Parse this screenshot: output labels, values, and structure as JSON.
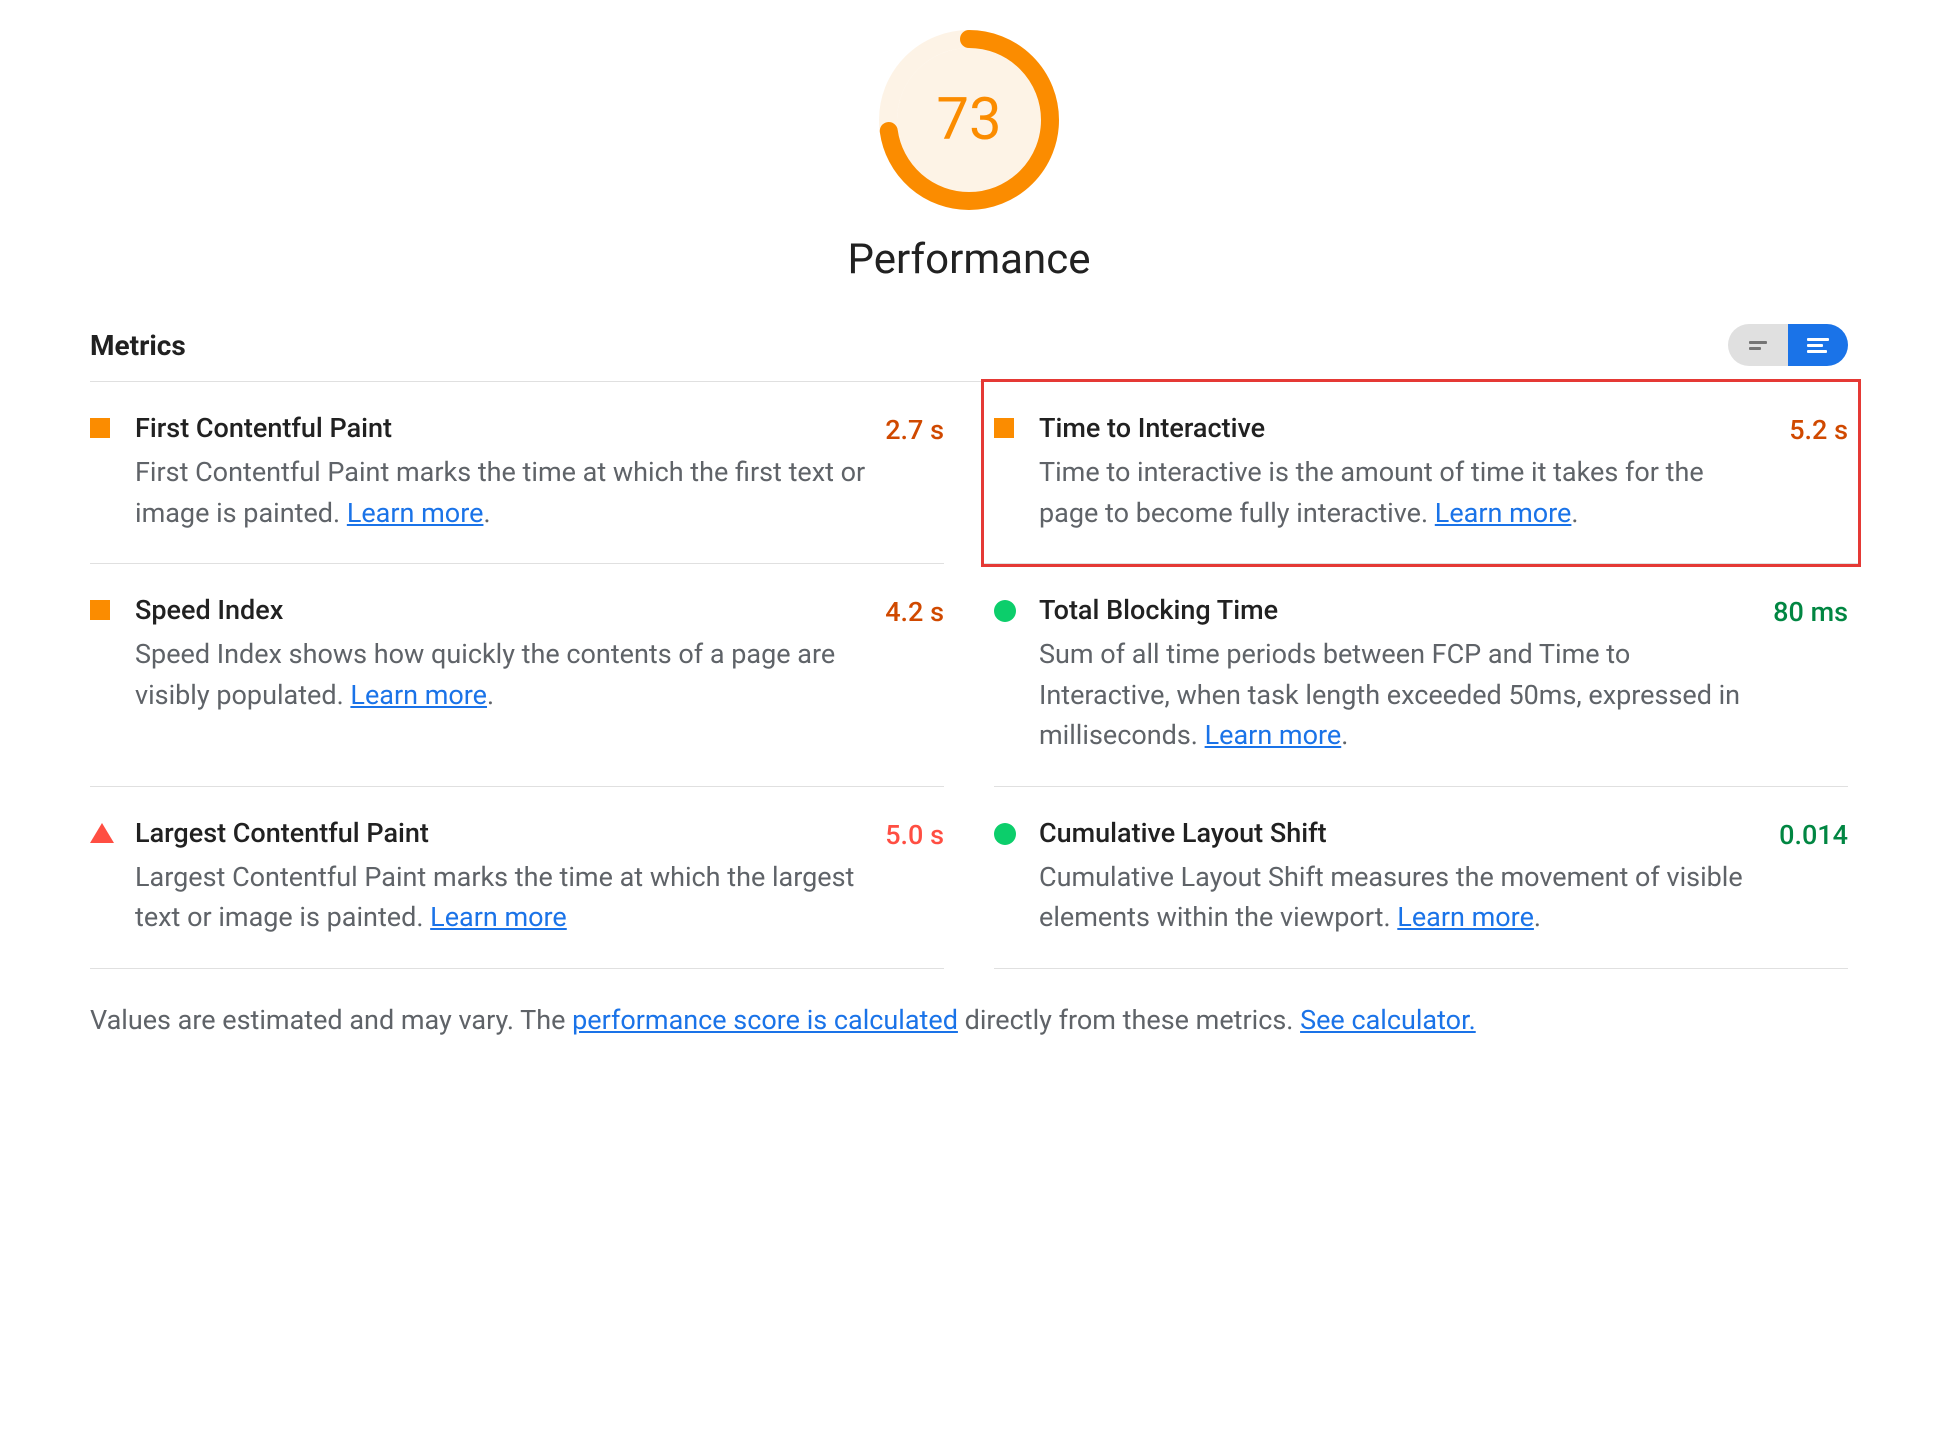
{
  "score": "73",
  "title": "Performance",
  "metrics_header": "Metrics",
  "learn_more": "Learn more",
  "metrics": [
    {
      "name": "First Contentful Paint",
      "desc_pre": "First Contentful Paint marks the time at which the first text or image is painted. ",
      "desc_post": ".",
      "value": "2.7 s",
      "status": "average",
      "highlight": false
    },
    {
      "name": "Time to Interactive",
      "desc_pre": "Time to interactive is the amount of time it takes for the page to become fully interactive. ",
      "desc_post": ".",
      "value": "5.2 s",
      "status": "average",
      "highlight": true
    },
    {
      "name": "Speed Index",
      "desc_pre": "Speed Index shows how quickly the contents of a page are visibly populated. ",
      "desc_post": ".",
      "value": "4.2 s",
      "status": "average",
      "highlight": false
    },
    {
      "name": "Total Blocking Time",
      "desc_pre": "Sum of all time periods between FCP and Time to Interactive, when task length exceeded 50ms, expressed in milliseconds. ",
      "desc_post": ".",
      "value": "80 ms",
      "status": "good",
      "highlight": false
    },
    {
      "name": "Largest Contentful Paint",
      "desc_pre": "Largest Contentful Paint marks the time at which the largest text or image is painted. ",
      "desc_post": "",
      "value": "5.0 s",
      "status": "poor",
      "highlight": false
    },
    {
      "name": "Cumulative Layout Shift",
      "desc_pre": "Cumulative Layout Shift measures the movement of visible elements within the viewport. ",
      "desc_post": ".",
      "value": "0.014",
      "status": "good",
      "highlight": false
    }
  ],
  "footer": {
    "pre": "Values are estimated and may vary. The ",
    "link1": "performance score is calculated",
    "mid": " directly from these metrics. ",
    "link2": "See calculator."
  }
}
